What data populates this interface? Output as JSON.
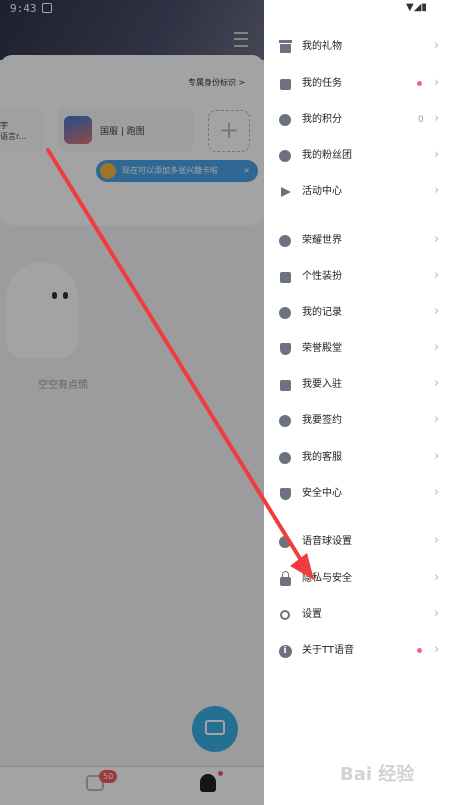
{
  "status": {
    "time": "9:43"
  },
  "background": {
    "tag": "专属身份标识 >",
    "tile1_text": "宇\n语言r...",
    "tile2_label": "国服 | 跑图",
    "plus": "+",
    "tip": "现在可以添加多张兴趣卡啦",
    "tip_close": "×",
    "empty_text": "空空有点慌",
    "message_badge": "50"
  },
  "drawer": {
    "items": [
      {
        "label": "我的礼物",
        "icon": "gift-icon",
        "chevron": "›"
      },
      {
        "label": "我的任务",
        "icon": "task-icon",
        "chevron": "›",
        "dot": true
      },
      {
        "label": "我的积分",
        "icon": "points-icon",
        "chevron": "›",
        "count": "0"
      },
      {
        "label": "我的粉丝团",
        "icon": "fans-icon",
        "chevron": "›"
      },
      {
        "label": "活动中心",
        "icon": "flag-icon",
        "chevron": "›"
      },
      {
        "label": "荣耀世界",
        "icon": "star-icon",
        "chevron": "›"
      },
      {
        "label": "个性装扮",
        "icon": "pin-icon",
        "chevron": "›"
      },
      {
        "label": "我的记录",
        "icon": "clock-icon",
        "chevron": "›"
      },
      {
        "label": "荣誉殿堂",
        "icon": "shield-icon",
        "chevron": "›"
      },
      {
        "label": "我要入驻",
        "icon": "home-icon",
        "chevron": "›"
      },
      {
        "label": "我要签约",
        "icon": "sprout-icon",
        "chevron": "›"
      },
      {
        "label": "我的客服",
        "icon": "headset-icon",
        "chevron": "›"
      },
      {
        "label": "安全中心",
        "icon": "shield-plant-icon",
        "chevron": "›"
      },
      {
        "label": "语音球设置",
        "icon": "mic-icon",
        "chevron": "›"
      },
      {
        "label": "隐私与安全",
        "icon": "lock-icon",
        "chevron": "›"
      },
      {
        "label": "设置",
        "icon": "gear-icon",
        "chevron": "›"
      },
      {
        "label": "关于TT语音",
        "icon": "info-icon",
        "chevron": "›",
        "dot": true
      }
    ]
  },
  "watermark": "Bai 经验"
}
